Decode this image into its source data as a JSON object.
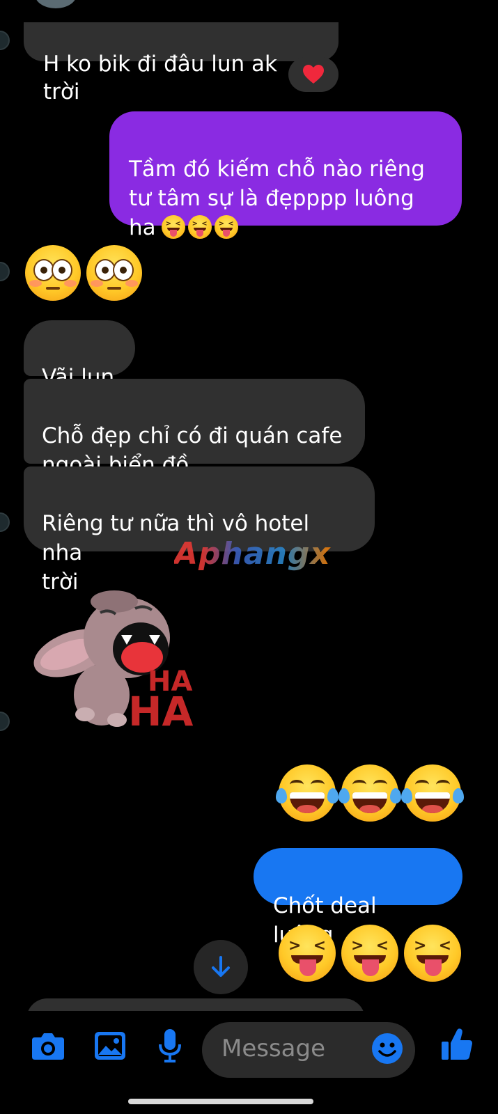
{
  "messages": {
    "m1": "H ko bik đi đâu lun ak trời",
    "m1_reaction": "❤️",
    "m2_text": "Tầm đó kiếm chỗ nào riêng\ntư tâm sự là đẹpppp luông\nha",
    "m3": "Vãi lun",
    "m4": "Chỗ đẹp chỉ có đi quán cafe\nngoài biển đồ",
    "m5": "Riêng tư nữa thì vô hotel nha\ntrời",
    "m6": "Chốt deal luông"
  },
  "watermark": "Aphangx",
  "sticker": {
    "text_top": "HA",
    "text_bottom": "HA"
  },
  "composer": {
    "placeholder": "Message",
    "icons": [
      "camera-icon",
      "image-icon",
      "microphone-icon",
      "emoji-icon",
      "thumbs-up-icon"
    ]
  },
  "colors": {
    "incoming_bubble": "#303030",
    "outgoing_purple": "#8a2be2",
    "outgoing_blue": "#1877f2",
    "accent": "#1877f2",
    "background": "#000000"
  }
}
